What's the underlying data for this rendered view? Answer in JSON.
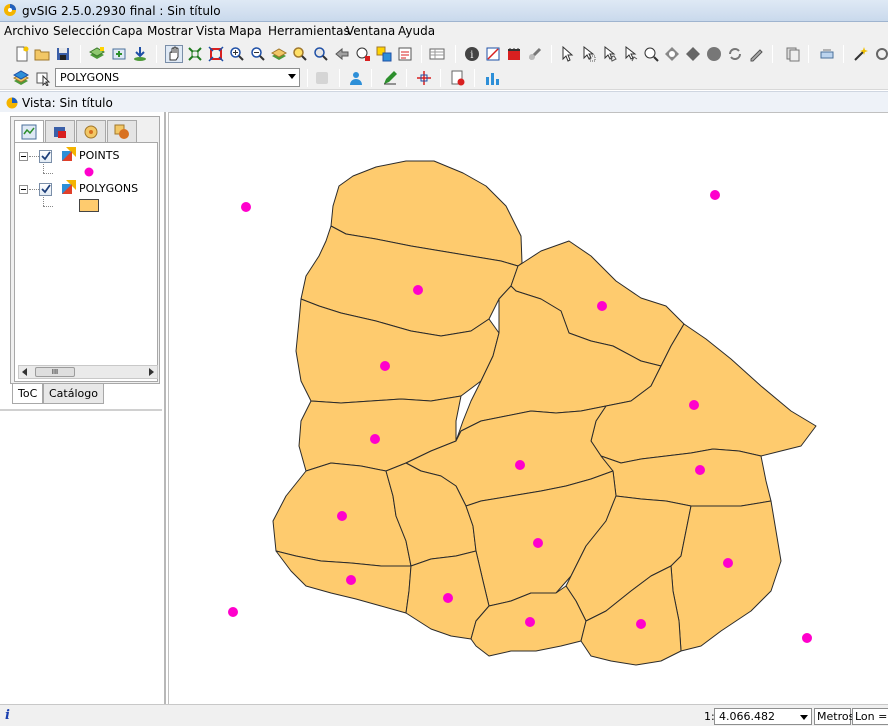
{
  "window": {
    "title": "gvSIG 2.5.0.2930 final : Sin título"
  },
  "menu": [
    "Archivo",
    "Selección",
    "Capa",
    "Mostrar",
    "Vista",
    "Mapa",
    "Herramientas",
    "Ventana",
    "Ayuda"
  ],
  "toolbar": {
    "active_layer": "POLYGONS"
  },
  "view": {
    "title": "Vista: Sin título"
  },
  "toc": {
    "layers": [
      {
        "name": "POINTS",
        "visible": true,
        "symbol": "point",
        "symbol_color": "#ff00cc"
      },
      {
        "name": "POLYGONS",
        "visible": true,
        "symbol": "fill",
        "symbol_color": "#fecb6e"
      }
    ],
    "tabs": [
      "ToC",
      "Catálogo"
    ],
    "scroll_thumb_label": "III"
  },
  "map": {
    "polygon_fill": "#fecb6e",
    "outline": "#2b2b2b",
    "point_color": "#ff00cc"
  },
  "status": {
    "info_icon": "i",
    "scale_prefix": "1:",
    "scale": "4.066.482",
    "units": "Metros",
    "coords": "Lon = -"
  },
  "colors": {
    "accent": "#1a3fb0",
    "chrome": "#f0f0f0"
  }
}
